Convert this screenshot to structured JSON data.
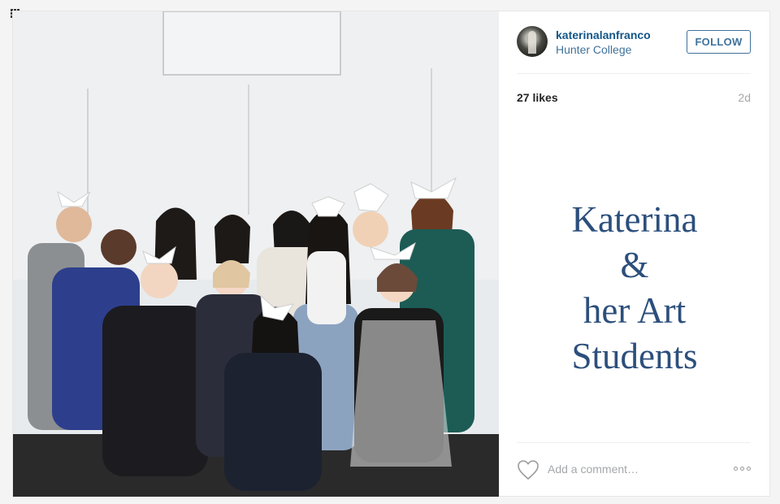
{
  "post": {
    "username": "katerinalanfranco",
    "location": "Hunter College",
    "follow_label": "FOLLOW",
    "likes": "27 likes",
    "age": "2d",
    "caption_lines": [
      "Katerina",
      "&",
      "her Art",
      "Students"
    ],
    "comment_placeholder": "Add a comment…"
  },
  "icons": {
    "grid": "grid-icon",
    "heart": "heart-icon",
    "more": "more-options-icon"
  },
  "colors": {
    "username": "#125688",
    "location": "#3f729b",
    "follow": "#3f729b",
    "caption": "#2c4f7c",
    "muted": "#a5a7aa"
  }
}
